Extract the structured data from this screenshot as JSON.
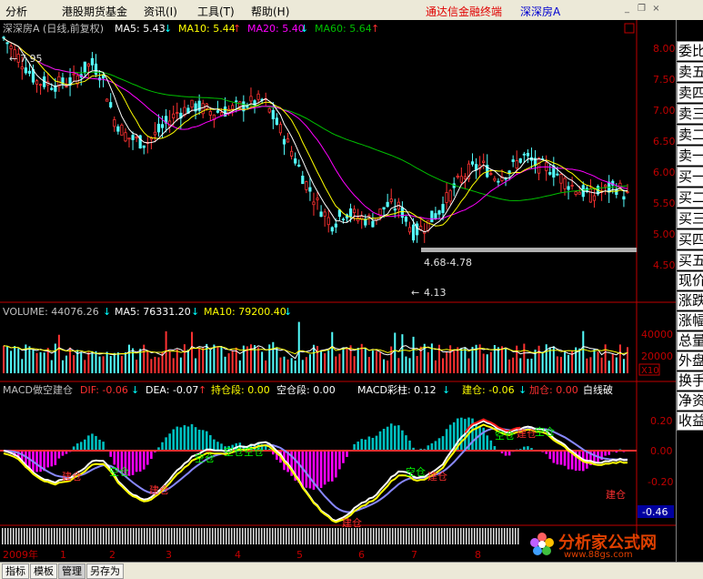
{
  "menu": {
    "items": [
      "分析",
      "港股期货基金",
      "资讯(I)",
      "工具(T)",
      "帮助(H)"
    ],
    "brand": "通达信金融终端",
    "security": "深深房A"
  },
  "price_panel": {
    "title": "深深房A (日线,前复权)",
    "ma5": "MA5: 5.43",
    "ma5_arrow": "↓",
    "ma10": "MA10: 5.44",
    "ma10_arrow": "↑",
    "ma20": "MA20: 5.40",
    "ma20_arrow": "↓",
    "ma60": "MA60: 5.64",
    "ma60_arrow": "↑",
    "high_label": "7.95",
    "low_label": "4.13",
    "range_label": "4.68-4.78",
    "y_ticks": [
      "8.00",
      "7.50",
      "7.00",
      "6.50",
      "6.00",
      "5.50",
      "5.00",
      "4.50"
    ]
  },
  "volume_panel": {
    "title": "VOLUME: 44076.26",
    "title_arrow": "↓",
    "ma5": "MA5: 76331.20",
    "ma5_arrow": "↓",
    "ma10": "MA10: 79200.40",
    "ma10_arrow": "↓",
    "y_ticks": [
      "40000",
      "20000"
    ],
    "unit": "X10"
  },
  "macd_panel": {
    "title": "MACD做空建仓",
    "dif": "DIF: -0.06",
    "dif_arrow": "↓",
    "dea": "DEA: -0.07",
    "dea_arrow": "↑",
    "hold": "持仓段: 0.00",
    "empty": "空仓段: 0.00",
    "bar": "MACD彩柱: 0.12",
    "bar_arrow": "↓",
    "build": "建仓: -0.06",
    "build_arrow": "↓",
    "add": "加仓: 0.00",
    "white": "白线破",
    "y_ticks": [
      "0.20",
      "0.00",
      "-0.20"
    ],
    "current": "-0.46",
    "labels": [
      {
        "text": "建仓",
        "color": "#ff3030"
      },
      {
        "text": "空仓",
        "color": "#00ff00"
      },
      {
        "text": "建仓",
        "color": "#ff3030"
      },
      {
        "text": "空仓",
        "color": "#00ff00"
      },
      {
        "text": "空仓空仓",
        "color": "#00ff00"
      },
      {
        "text": "建仓",
        "color": "#ff3030"
      },
      {
        "text": "空仓",
        "color": "#00ff00"
      },
      {
        "text": "建仓",
        "color": "#ff3030"
      },
      {
        "text": "空仓",
        "color": "#00ff00"
      },
      {
        "text": "空仓",
        "color": "#00ff00"
      },
      {
        "text": "建仓",
        "color": "#ff3030"
      },
      {
        "text": "建仓",
        "color": "#ff3030"
      }
    ]
  },
  "x_axis": {
    "year": "2009年",
    "months": [
      "1",
      "2",
      "3",
      "4",
      "5",
      "6",
      "7",
      "8"
    ]
  },
  "right_panel": {
    "tabs": [
      "委比",
      "卖五",
      "卖四",
      "卖三",
      "卖二",
      "卖一",
      "买一",
      "买二",
      "买三",
      "买四",
      "买五"
    ],
    "tabs2": [
      "现价",
      "涨跌",
      "涨幅",
      "总量",
      "外盘",
      "换手",
      "净资",
      "收益"
    ]
  },
  "bottom_tabs": [
    "指标",
    "模板",
    "管理",
    "另存为"
  ],
  "logo": {
    "name": "分析家公式网",
    "url": "www.88gs.com"
  },
  "colors": {
    "up": "#ff3232",
    "down": "#54ffff",
    "ma5": "#ffffff",
    "ma10": "#ffff00",
    "ma20": "#ff00ff",
    "ma60": "#00c000",
    "macd_pos": "#00c0c0",
    "macd_neg": "#ff00ff",
    "dif": "#ffffff",
    "dea": "#8888ff",
    "build": "#ffff00",
    "axis": "#c00000"
  }
}
